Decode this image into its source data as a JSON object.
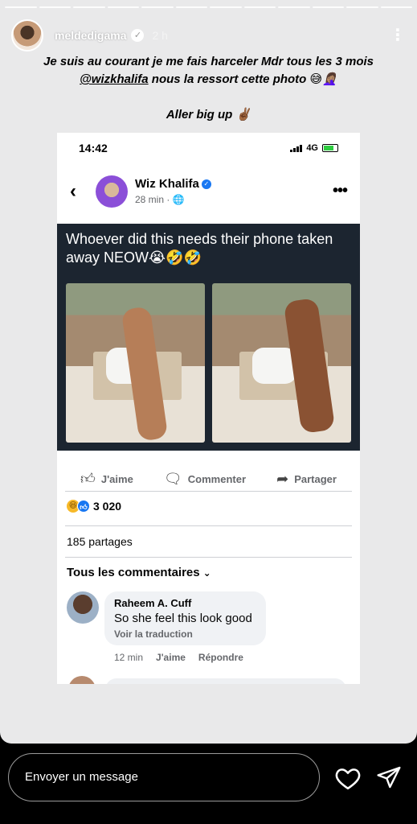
{
  "story": {
    "username": "meldedigama",
    "time_ago": "2 h",
    "caption_part1": "Je suis au courant je me fais harceler Mdr tous les 3 mois ",
    "caption_mention": "@wizkhalifa",
    "caption_part2": " nous la ressort cette photo 😅🤦🏽‍♀️",
    "caption_line2": "Aller big up ✌🏾",
    "progress_segments": 12
  },
  "phone": {
    "clock": "14:42",
    "network": "4G"
  },
  "post": {
    "author": "Wiz Khalifa",
    "time": "28 min · ",
    "globe_icon": "🌐",
    "meme_text": "Whoever did this needs their phone taken away NEOW😭🤣🤣",
    "like_label": "J'aime",
    "comment_label": "Commenter",
    "share_label": "Partager",
    "reaction_count": "3 020",
    "shares": "185 partages",
    "all_comments": "Tous les commentaires"
  },
  "comment": {
    "author": "Raheem A. Cuff",
    "text": "So she feel this look good",
    "translate": "Voir la traduction",
    "time": "12 min",
    "like": "J'aime",
    "reply": "Répondre"
  },
  "bottom_bar": {
    "message_placeholder": "Envoyer un message"
  }
}
